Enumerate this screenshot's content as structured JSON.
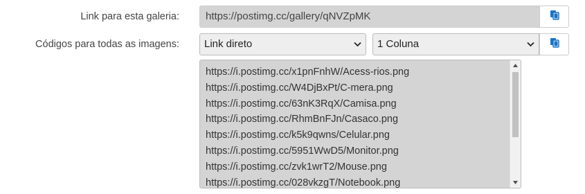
{
  "gallery": {
    "label": "Link para esta galeria:",
    "url": "https://postimg.cc/gallery/qNVZpMK",
    "copy_icon": "clipboard-copy-icon"
  },
  "codes": {
    "label": "Códigos para todas as imagens:",
    "format_selected": "Link direto",
    "columns_selected": "1 Coluna",
    "copy_icon": "clipboard-copy-icon",
    "lines": [
      "https://i.postimg.cc/x1pnFnhW/Acess-rios.png",
      "https://i.postimg.cc/W4DjBxPt/C-mera.png",
      "https://i.postimg.cc/63nK3RqX/Camisa.png",
      "https://i.postimg.cc/RhmBnFJn/Casaco.png",
      "https://i.postimg.cc/k5k9qwns/Celular.png",
      "https://i.postimg.cc/5951WwD5/Monitor.png",
      "https://i.postimg.cc/zvk1wrT2/Mouse.png",
      "https://i.postimg.cc/028vkzgT/Notebook.png"
    ]
  },
  "colors": {
    "icon_blue": "#1a73c8",
    "readonly_bg": "#d4d4d4"
  }
}
